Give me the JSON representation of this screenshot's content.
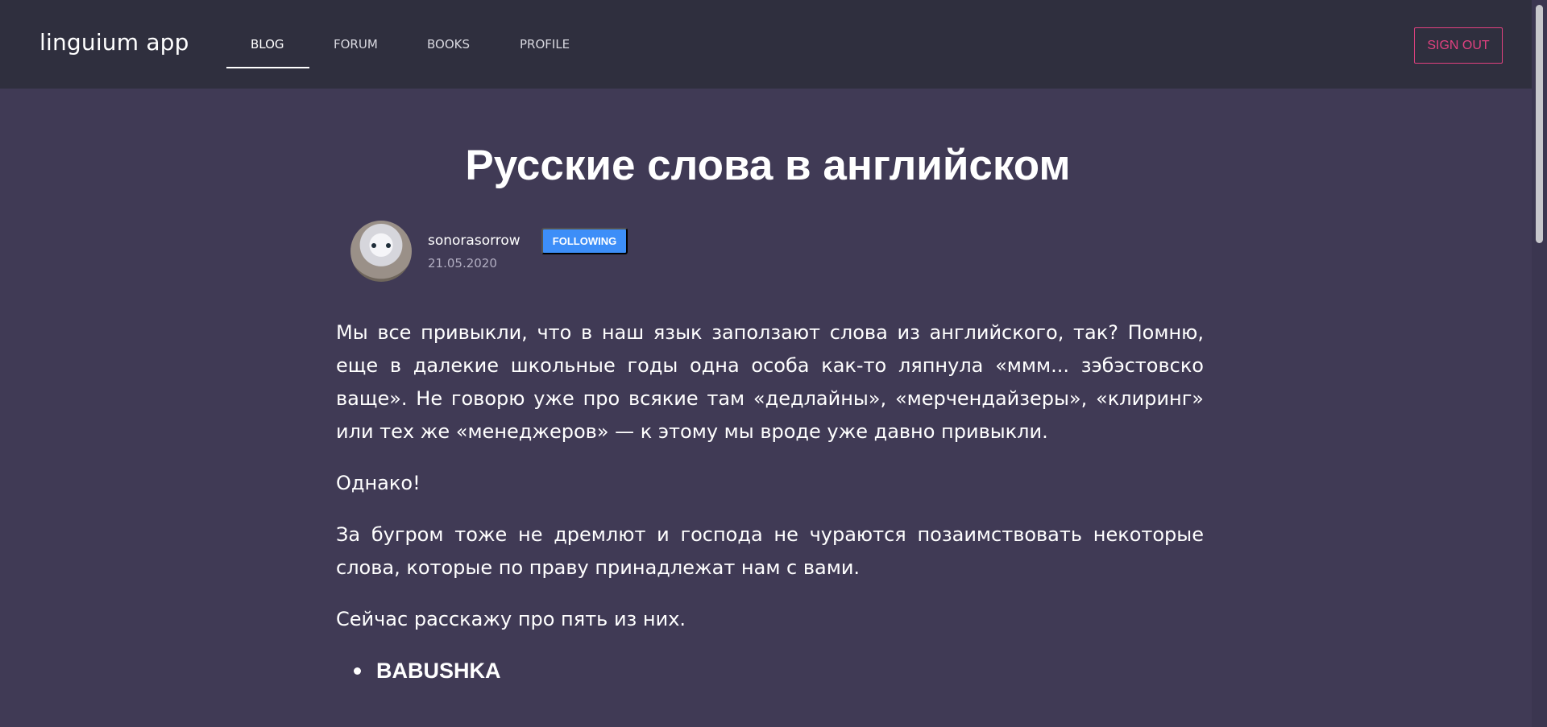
{
  "app": {
    "brand": "linguium app"
  },
  "nav": {
    "items": [
      {
        "label": "BLOG",
        "active": true
      },
      {
        "label": "FORUM",
        "active": false
      },
      {
        "label": "BOOKS",
        "active": false
      },
      {
        "label": "PROFILE",
        "active": false
      }
    ],
    "sign_out": "SIGN OUT"
  },
  "post": {
    "title": "Русские слова в английском",
    "author": "sonorasorrow",
    "follow_label": "FOLLOWING",
    "date": "21.05.2020",
    "paragraphs": [
      "Мы все привыкли, что в наш язык заползают слова из английского, так? Помню, еще в далекие школьные годы одна особа как-то ляпнула «ммм... зэбэстовско ваще». Не говорю уже про всякие там «дедлайны», «мерчендайзеры», «клиринг» или тех же «менеджеров» — к этому мы вроде уже давно привыкли.",
      "Однако!",
      "За бугром тоже не дремлют и господа не чураются позаимствовать некоторые слова, которые по праву принадлежат нам с вами.",
      "Сейчас расскажу про пять из них."
    ],
    "list_items": [
      "BABUSHKA"
    ]
  },
  "colors": {
    "navbar_bg": "#2f2f3e",
    "page_bg": "#403a55",
    "accent_signout": "#e1417f",
    "follow_button": "#3d8ef8"
  }
}
